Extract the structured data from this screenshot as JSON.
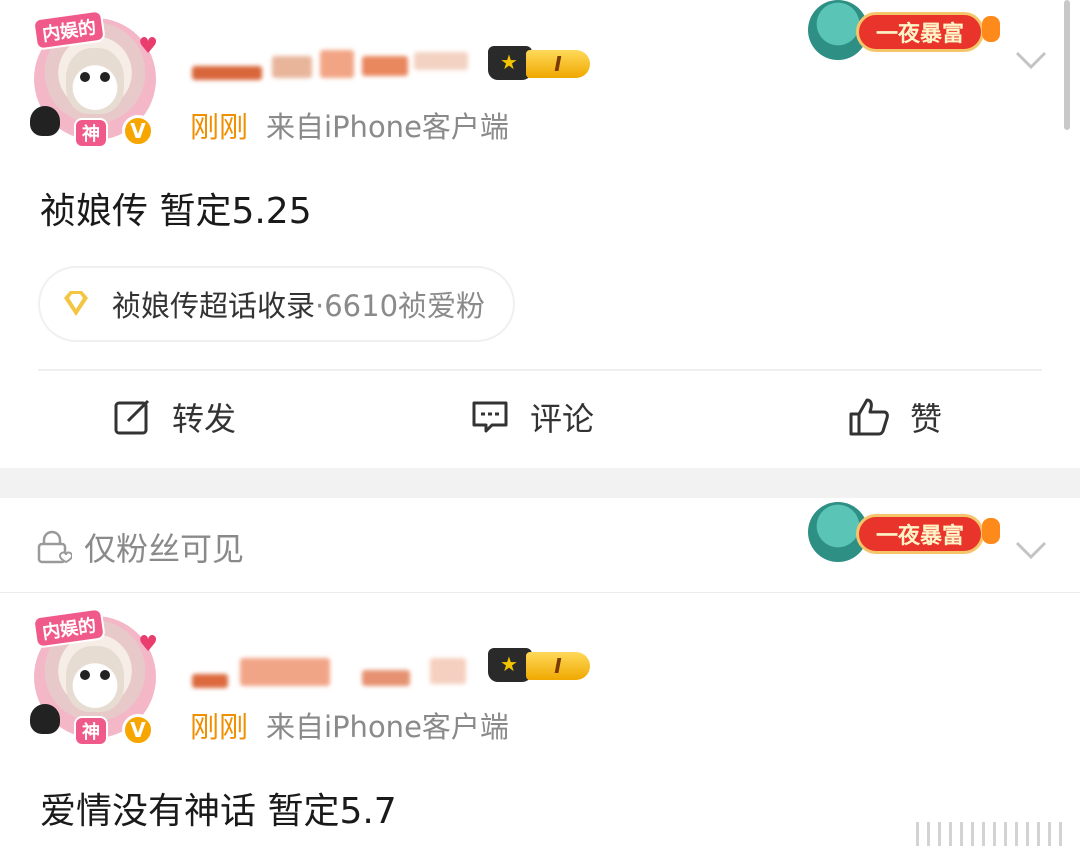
{
  "posts": [
    {
      "avatar_tag": "内娱的",
      "avatar_tag2": "神",
      "verified_mark": "V",
      "level_badge": "I",
      "time": "刚刚",
      "source": "来自iPhone客户端",
      "text": "祯娘传 暂定5.25",
      "topic": {
        "label": "祯娘传超话收录",
        "count": "·6610祯爱粉"
      },
      "actions": {
        "repost": "转发",
        "comment": "评论",
        "like": "赞"
      },
      "promo": "一夜暴富"
    },
    {
      "visibility": "仅粉丝可见",
      "avatar_tag": "内娱的",
      "avatar_tag2": "神",
      "verified_mark": "V",
      "level_badge": "I",
      "time": "刚刚",
      "source": "来自iPhone客户端",
      "text": "爱情没有神话 暂定5.7",
      "promo": "一夜暴富"
    }
  ],
  "colors": {
    "accent_time": "#f08f00",
    "badge_gold": "#f7a600",
    "promo_red": "#e8342a"
  }
}
